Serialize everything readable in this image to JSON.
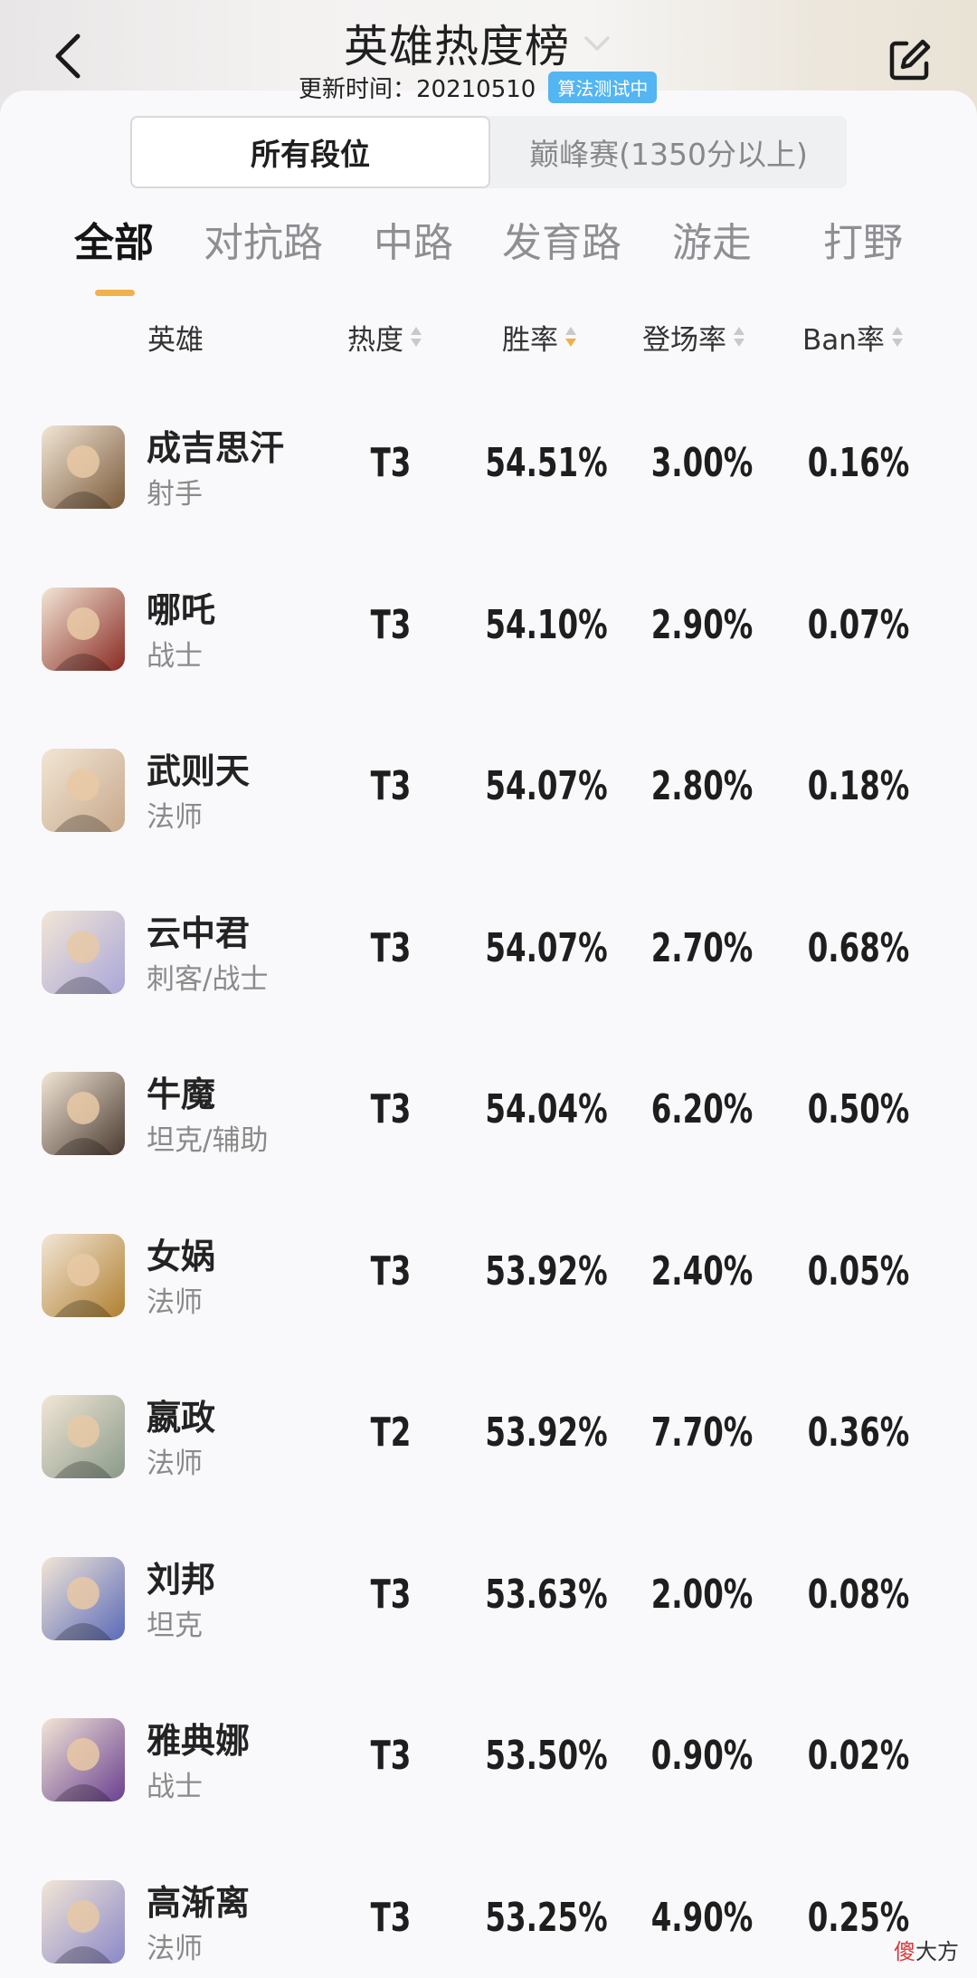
{
  "header": {
    "title": "英雄热度榜",
    "update_label": "更新时间：20210510",
    "badge": "算法测试中"
  },
  "segments": [
    {
      "label": "所有段位",
      "active": true
    },
    {
      "label": "巅峰赛(1350分以上)",
      "active": false
    }
  ],
  "tabs": [
    {
      "label": "全部",
      "active": true
    },
    {
      "label": "对抗路",
      "active": false
    },
    {
      "label": "中路",
      "active": false
    },
    {
      "label": "发育路",
      "active": false
    },
    {
      "label": "游走",
      "active": false
    },
    {
      "label": "打野",
      "active": false
    }
  ],
  "columns": {
    "hero": "英雄",
    "heat": "热度",
    "win": "胜率",
    "pick": "登场率",
    "ban": "Ban率"
  },
  "rows": [
    {
      "name": "成吉思汗",
      "role": "射手",
      "tier": "T3",
      "win": "54.51%",
      "pick": "3.00%",
      "ban": "0.16%",
      "color": "#7a5a3a"
    },
    {
      "name": "哪吒",
      "role": "战士",
      "tier": "T3",
      "win": "54.10%",
      "pick": "2.90%",
      "ban": "0.07%",
      "color": "#8a2a22"
    },
    {
      "name": "武则天",
      "role": "法师",
      "tier": "T3",
      "win": "54.07%",
      "pick": "2.80%",
      "ban": "0.18%",
      "color": "#c7a88a"
    },
    {
      "name": "云中君",
      "role": "刺客/战士",
      "tier": "T3",
      "win": "54.07%",
      "pick": "2.70%",
      "ban": "0.68%",
      "color": "#a9a6d8"
    },
    {
      "name": "牛魔",
      "role": "坦克/辅助",
      "tier": "T3",
      "win": "54.04%",
      "pick": "6.20%",
      "ban": "0.50%",
      "color": "#4a3a30"
    },
    {
      "name": "女娲",
      "role": "法师",
      "tier": "T3",
      "win": "53.92%",
      "pick": "2.40%",
      "ban": "0.05%",
      "color": "#b08030"
    },
    {
      "name": "嬴政",
      "role": "法师",
      "tier": "T2",
      "win": "53.92%",
      "pick": "7.70%",
      "ban": "0.36%",
      "color": "#8a9a8a"
    },
    {
      "name": "刘邦",
      "role": "坦克",
      "tier": "T3",
      "win": "53.63%",
      "pick": "2.00%",
      "ban": "0.08%",
      "color": "#5a6ab8"
    },
    {
      "name": "雅典娜",
      "role": "战士",
      "tier": "T3",
      "win": "53.50%",
      "pick": "0.90%",
      "ban": "0.02%",
      "color": "#6a4090"
    },
    {
      "name": "高渐离",
      "role": "法师",
      "tier": "T3",
      "win": "53.25%",
      "pick": "4.90%",
      "ban": "0.25%",
      "color": "#8a88c8"
    }
  ],
  "watermark": {
    "red": "傻",
    "rest": "大方"
  }
}
